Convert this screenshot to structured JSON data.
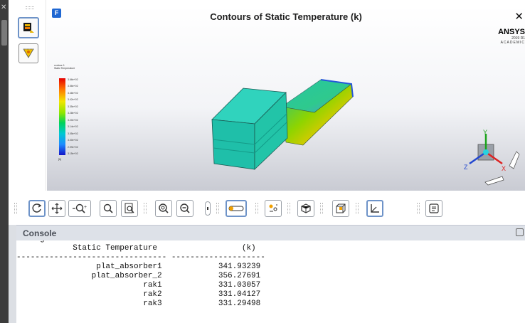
{
  "window": {
    "title": "Contours of Static Temperature (k)",
    "close_glyph": "✕",
    "app_badge": "F",
    "brand_word": "ANSYS",
    "brand_sub": "2019 R1",
    "brand_academic": "ACADEMIC"
  },
  "legend": {
    "title_line1": "contour-1",
    "title_line2": "Static Temperature",
    "ticks": [
      "3.66e+02",
      "3.56e+02",
      "3.48e+02",
      "3.42e+02",
      "3.35e+02",
      "3.28e+02",
      "3.20e+02",
      "3.14e+02",
      "3.05e+02",
      "3.00e+02",
      "2.99e+02",
      "3.15e+02"
    ],
    "unit": "[k]"
  },
  "side_tools": [
    {
      "name": "contour-tool-icon"
    },
    {
      "name": "colormap-tool-icon"
    }
  ],
  "toolbar": [
    {
      "name": "rotate-icon"
    },
    {
      "name": "pan-icon"
    },
    {
      "name": "zoom-in-icon"
    },
    {
      "name": "zoom-icon"
    },
    {
      "name": "zoom-box-icon"
    },
    {
      "name": "fit-zoom-icon"
    },
    {
      "name": "zoom-out-icon"
    },
    {
      "name": "probe-icon"
    },
    {
      "name": "ruler-icon"
    },
    {
      "name": "annotate-icon"
    },
    {
      "name": "view-orient-icon"
    },
    {
      "name": "cube-view-icon"
    },
    {
      "name": "axes-icon"
    },
    {
      "name": "text-icon"
    }
  ],
  "console": {
    "title": "Console",
    "lines": [
      "Average of Surface Vertex Values",
      "            Static Temperature                  (k)",
      "-------------------------------- --------------------",
      "                 plat_absorber1            341.93239",
      "                plat_absorber_2            356.27691",
      "                           rak1            331.03057",
      "                           rak2            331.04127",
      "                           rak3            331.29498"
    ]
  },
  "colors": {
    "accent": "#6e93c8",
    "geometry_main": "#22c9a9",
    "console_header": "#dde1e8"
  }
}
